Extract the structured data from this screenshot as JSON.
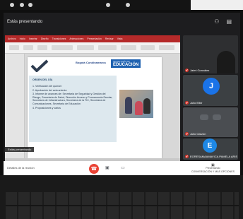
{
  "meeting": {
    "title": "Estás presentando",
    "top_icons": [
      "people-icon",
      "chat-icon"
    ]
  },
  "presentation": {
    "ribbon_tabs": [
      "Archivo",
      "Inicio",
      "Insertar",
      "Diseño",
      "Transiciones",
      "Animaciones",
      "Presentación",
      "Revisar",
      "Vista"
    ],
    "slide": {
      "logo_left": "Bogotá Cundinamarca",
      "edu_small": "SECRETARÍA DE",
      "edu_big": "EDUCACIÓN",
      "agenda_title": "ORDEN DEL DÍA",
      "agenda_items": [
        "1.  Verificación del quórum",
        "2.  Aprobación del acta anterior",
        "3.  Informe de avances de: Secretaría de Seguridad y Gestión del Riesgo, Secretaría de Salud, Dirección Acceso y Permanencia Escolar, Secretaría de Infraestructura, Secretaría de la TIC, Secretaría de Comunicaciones, Secretaría de Educación",
        "4.  Proposiciones y varios"
      ]
    },
    "presenter_tag": "Estás presentando"
  },
  "participants": [
    {
      "name": "Jaimi González",
      "muted": true
    },
    {
      "name": "Julio Elbir",
      "initial": "J",
      "avatar_color": "#1a73e8",
      "muted": true
    },
    {
      "name": "Julio Garzón",
      "muted": true
    },
    {
      "name": "EGRESAMAAMAVICA PAMELA ARIS",
      "initial": "E",
      "avatar_color": "#1e88e5",
      "muted": true
    }
  ],
  "toolbar": {
    "left_label": "Detalles de la reunión",
    "end_call_icon": "call-end-icon",
    "right_label_1": "Presentando",
    "right_label_2": "CONVERSACIÓN Y MÁS OPCIONES"
  }
}
